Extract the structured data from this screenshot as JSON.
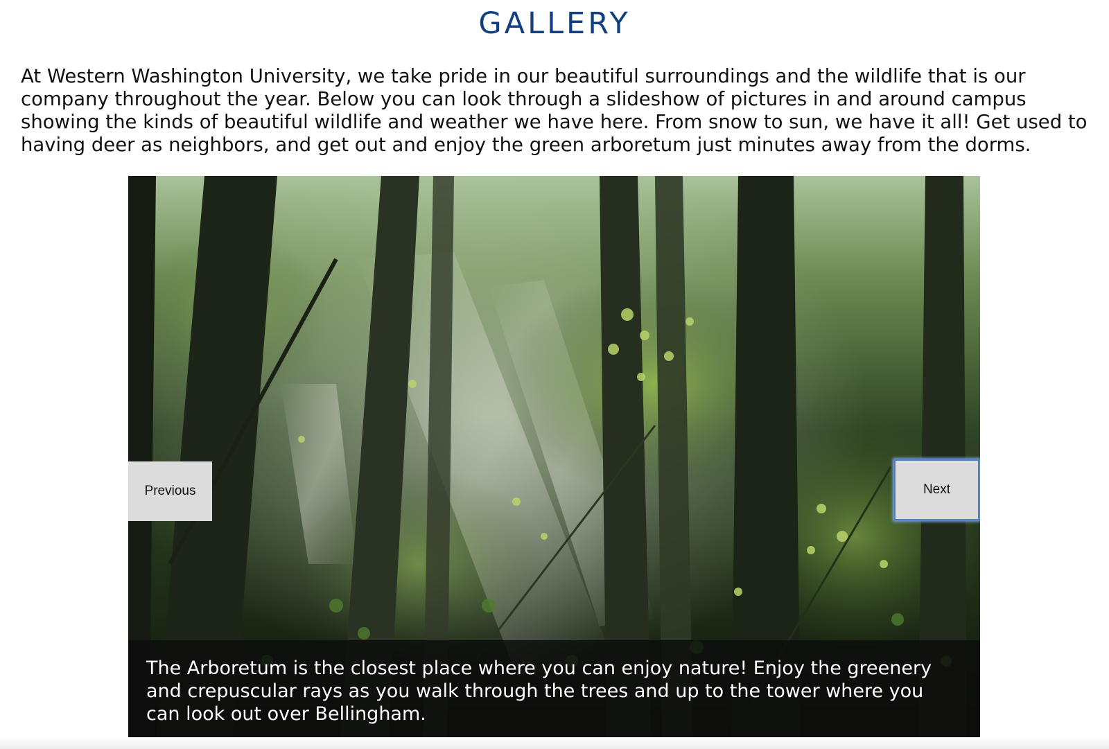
{
  "page": {
    "title": "GALLERY",
    "intro": "At Western Washington University, we take pride in our beautiful surroundings and the wildlife that is our company throughout the year. Below you can look through a slideshow of pictures in and around campus showing the kinds of beautiful wildlife and weather we have here. From snow to sun, we have it all! Get used to having deer as neighbors, and get out and enjoy the green arboretum just minutes away from the dorms."
  },
  "slideshow": {
    "caption": "The Arboretum is the closest place where you can enjoy nature! Enjoy the greenery and crepuscular rays as you walk through the trees and up to the tower where you can look out over Bellingham.",
    "previous_label": "Previous",
    "next_label": "Next"
  },
  "colors": {
    "title": "#123f82",
    "button_bg": "#dcdcdc",
    "focus_ring": "#4f7fc9"
  }
}
